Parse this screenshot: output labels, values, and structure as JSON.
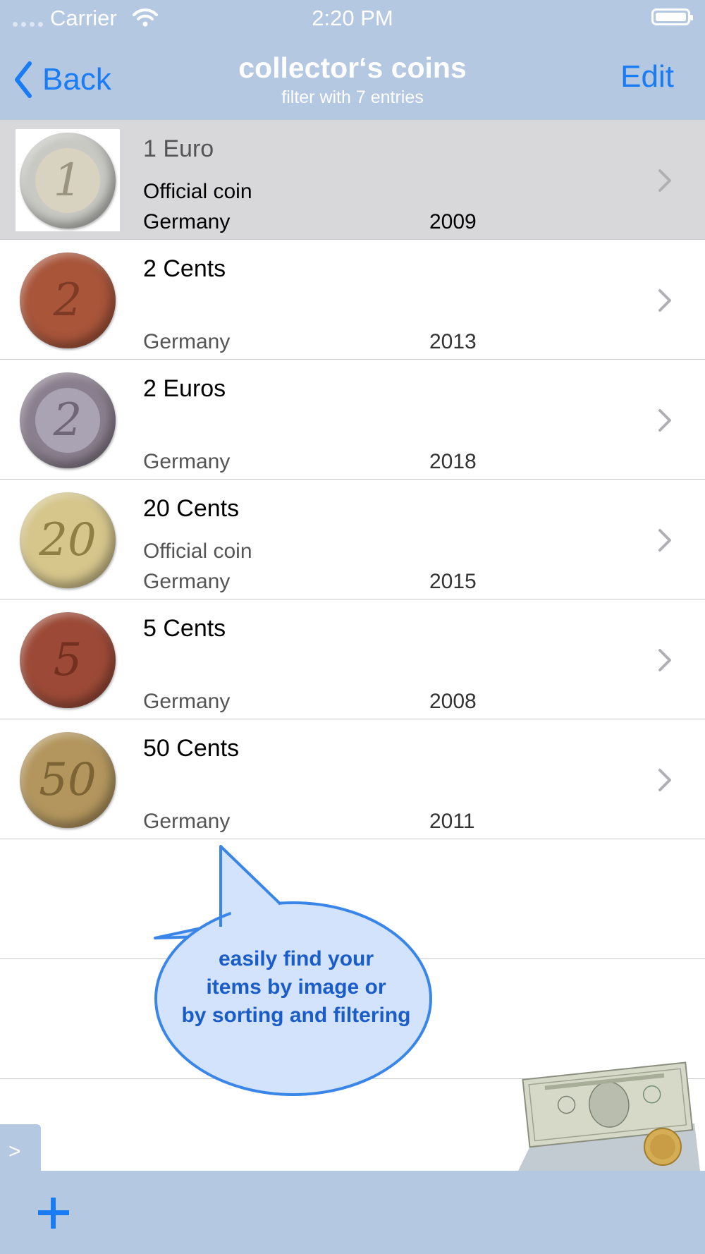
{
  "status_bar": {
    "carrier": "Carrier",
    "time": "2:20 PM"
  },
  "nav": {
    "back_label": "Back",
    "title": "collector‘s coins",
    "subtitle": "filter with 7 entries",
    "edit_label": "Edit"
  },
  "items": [
    {
      "title": "1 Euro",
      "subtitle": "Official coin",
      "country": "Germany",
      "year": "2009",
      "selected": true,
      "coin_icon": "one-euro-coin-image"
    },
    {
      "title": "2 Cents",
      "subtitle": "",
      "country": "Germany",
      "year": "2013",
      "selected": false,
      "coin_icon": "two-cent-coin-image"
    },
    {
      "title": "2 Euros",
      "subtitle": "",
      "country": "Germany",
      "year": "2018",
      "selected": false,
      "coin_icon": "two-euro-coin-image"
    },
    {
      "title": "20 Cents",
      "subtitle": "Official coin",
      "country": "Germany",
      "year": "2015",
      "selected": false,
      "coin_icon": "twenty-cent-coin-image"
    },
    {
      "title": "5 Cents",
      "subtitle": "",
      "country": "Germany",
      "year": "2008",
      "selected": false,
      "coin_icon": "five-cent-coin-image"
    },
    {
      "title": "50 Cents",
      "subtitle": "",
      "country": "Germany",
      "year": "2011",
      "selected": false,
      "coin_icon": "fifty-cent-coin-image"
    }
  ],
  "callout": {
    "lines": [
      "easily find your",
      "items by image or",
      "by sorting and filtering"
    ]
  },
  "side_tab": {
    "label": ">"
  },
  "toolbar": {
    "add_icon": "plus-icon"
  },
  "colors": {
    "bar": "#b4c8e2",
    "accent": "#1a7cf5",
    "selected_row": "#d8d8da",
    "callout_fill": "#d3e3fb",
    "callout_stroke": "#3a86e8"
  }
}
